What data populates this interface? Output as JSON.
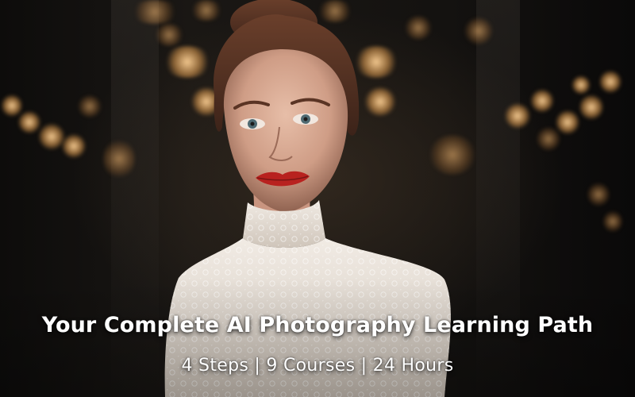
{
  "banner": {
    "title": "Your Complete AI Photography Learning Path",
    "subtitle": "4 Steps | 9 Courses | 24 Hours"
  },
  "image": {
    "subject": "portrait-photo",
    "colors": {
      "lip": "#b8221f",
      "lace": "#e9e2da",
      "hair": "#5a3424",
      "skin": "#dcae98",
      "bokeh": "#f2c27a"
    }
  }
}
